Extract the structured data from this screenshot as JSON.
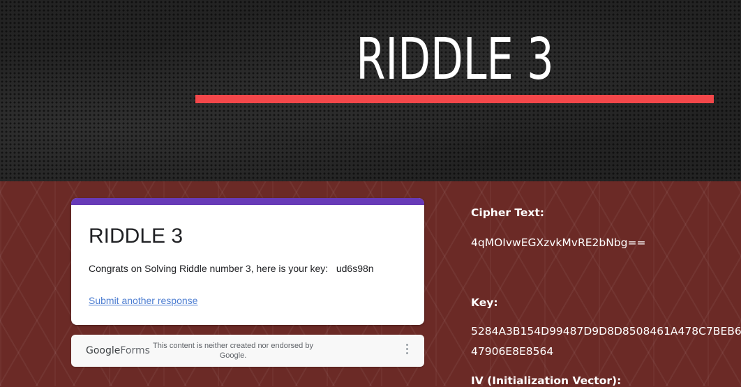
{
  "hero": {
    "title": "RIDDLE 3",
    "accent_color": "#f4474a"
  },
  "form": {
    "title": "RIDDLE 3",
    "message": "Congrats on Solving Riddle number 3, here is your key:   ud6s98n",
    "link_label": "Submit another response",
    "accent_color": "#673ab7"
  },
  "footer": {
    "logo_google": "Google",
    "logo_forms": "Forms",
    "disclaimer": "This content is neither created nor endorsed by Google.",
    "menu_icon": "kebab-menu-icon"
  },
  "side": {
    "cipher_label": "Cipher Text:",
    "cipher_value": "4qMOIvwEGXzvkMvRE2bNbg==",
    "key_label": "Key:",
    "key_line1": "5284A3B154D99487D9D8D8508461A478C7BEB6",
    "key_line2": "47906E8E8564",
    "iv_label": "IV (Initialization Vector):"
  }
}
